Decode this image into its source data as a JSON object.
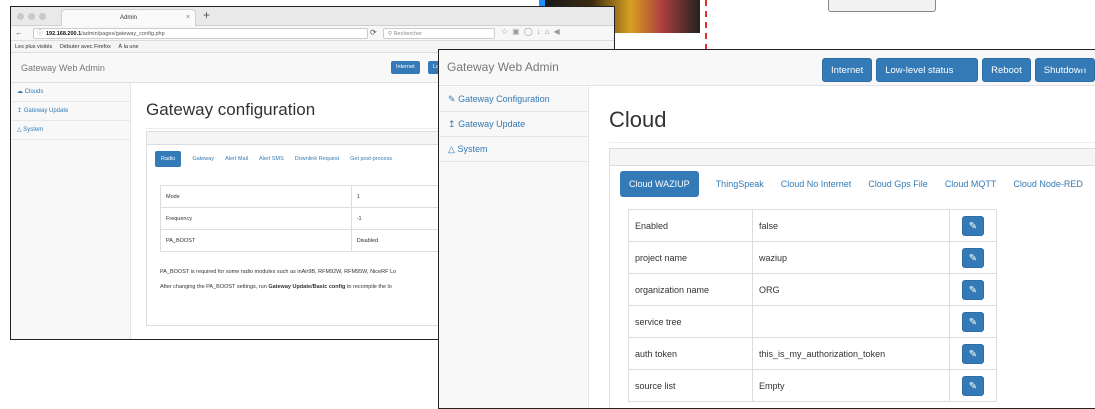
{
  "background_window": {
    "tab_title": "Admin",
    "tab_close": "×",
    "new_tab": "+",
    "url_host": "192.168.200.1",
    "url_path": "/admin/pages/gateway_config.php",
    "search_placeholder": "Rechercher",
    "bookmarks": [
      "Les plus visités",
      "Débuter avec Firefox",
      "À la une"
    ],
    "brand": "Gateway Web Admin",
    "nav_buttons": [
      "Internet",
      "Lo"
    ],
    "sidebar": [
      "Clouds",
      "Gateway Update",
      "System"
    ],
    "page_title": "Gateway configuration",
    "tabs": [
      "Radio",
      "Gateway",
      "Alert Mail",
      "Alert SMS",
      "Downlink Request",
      "Get post-process"
    ],
    "table": [
      {
        "key": "Mode",
        "value": "1"
      },
      {
        "key": "Frequency",
        "value": "-1"
      },
      {
        "key": "PA_BOOST",
        "value": "Disabled"
      }
    ],
    "note1": "PA_BOOST is required for some radio modules such as inAir9B, RFM92W, RFM95W, NiceRF Lo",
    "note2_prefix": "After changing the PA_BOOST settings, run ",
    "note2_bold": "Gateway Update/Basic config",
    "note2_suffix": " to recompile the lo"
  },
  "front_window": {
    "brand": "Gateway Web Admin",
    "nav_buttons": [
      "Internet",
      "Low-level status ON",
      "Reboot",
      "Shutdown"
    ],
    "user_menu": "▾",
    "sidebar": [
      "Gateway Configuration",
      "Gateway Update",
      "System"
    ],
    "page_title": "Cloud",
    "tabs": [
      "Cloud WAZIUP",
      "ThingSpeak",
      "Cloud No Internet",
      "Cloud Gps File",
      "Cloud MQTT",
      "Cloud Node-RED"
    ],
    "table": [
      {
        "key": "Enabled",
        "value": "false"
      },
      {
        "key": "project name",
        "value": "waziup"
      },
      {
        "key": "organization name",
        "value": "ORG"
      },
      {
        "key": "service tree",
        "value": ""
      },
      {
        "key": "auth token",
        "value": "this_is_my_authorization_token"
      },
      {
        "key": "source list",
        "value": "Empty"
      }
    ]
  },
  "colors": {
    "primary": "#337ab7",
    "accent_dash": "#e23030"
  }
}
